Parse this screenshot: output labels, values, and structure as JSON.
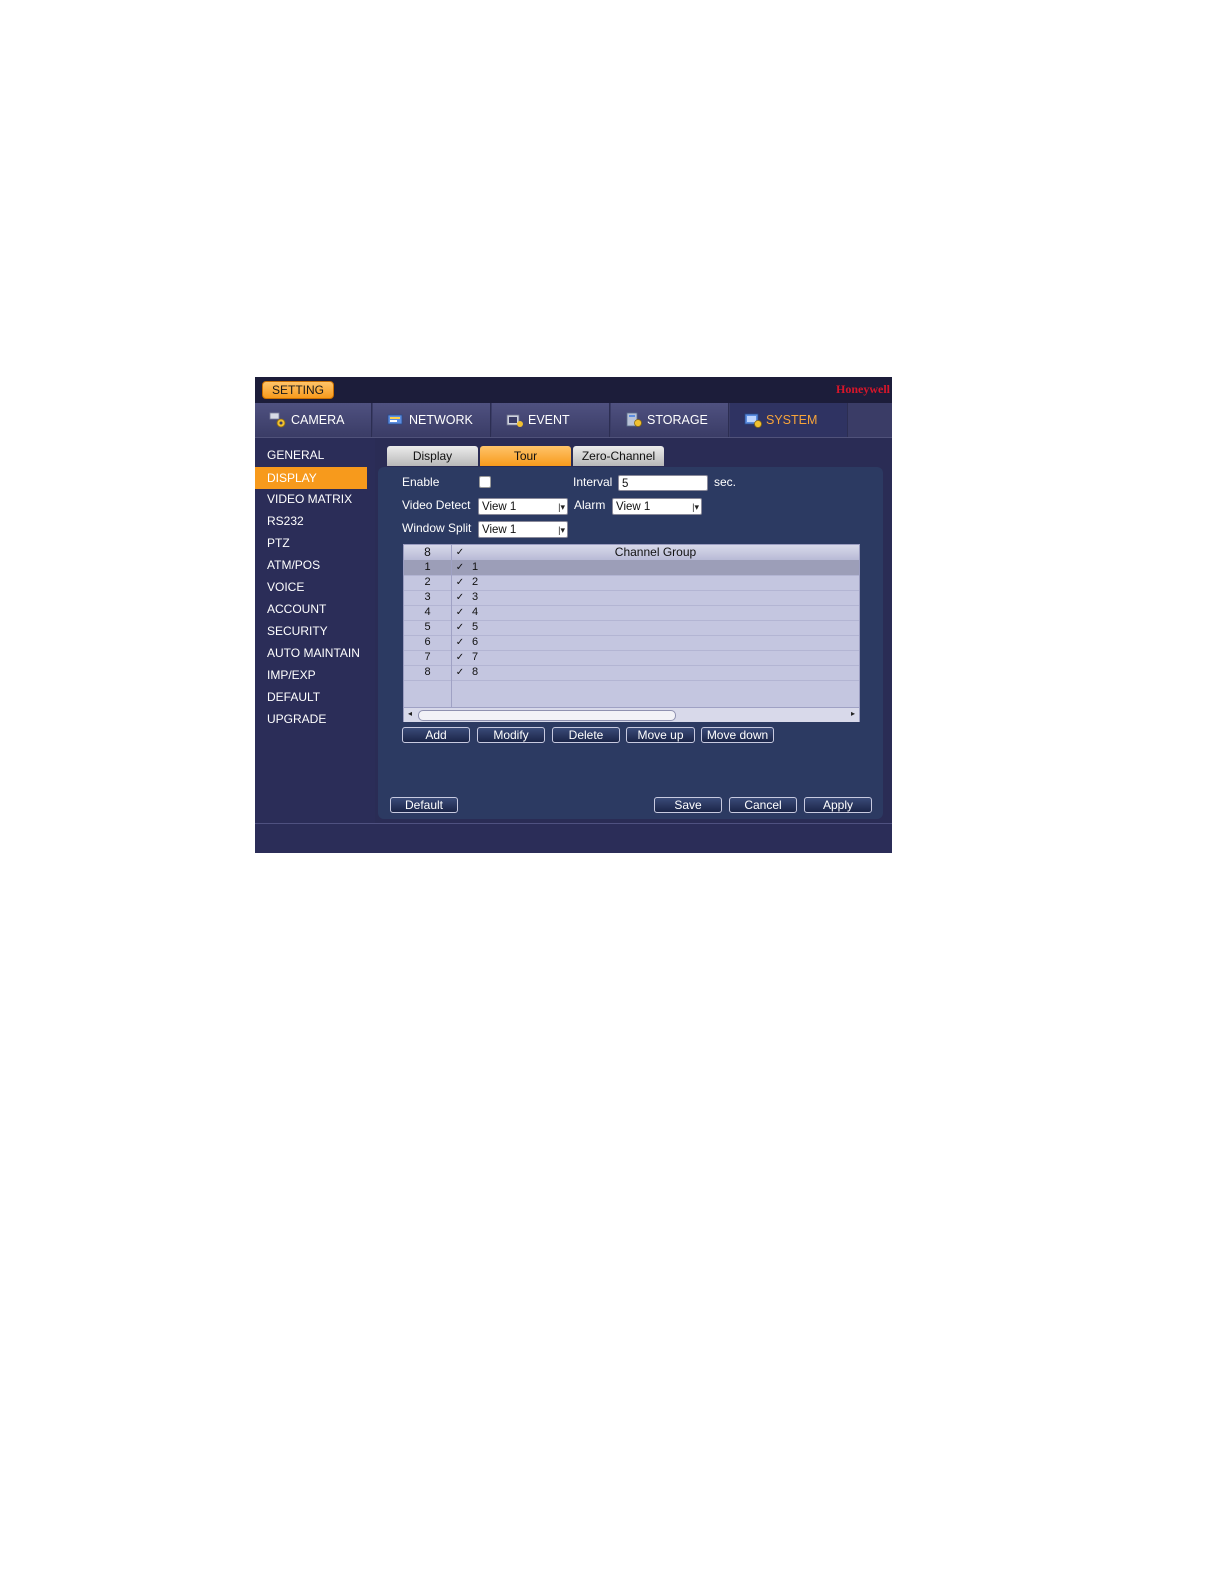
{
  "window": {
    "setting_label": "SETTING",
    "brand": "Honeywell"
  },
  "main_tabs": [
    {
      "label": "CAMERA",
      "icon": "camera-gear-icon",
      "active": false
    },
    {
      "label": "NETWORK",
      "icon": "network-icon",
      "active": false
    },
    {
      "label": "EVENT",
      "icon": "event-icon",
      "active": false
    },
    {
      "label": "STORAGE",
      "icon": "storage-icon",
      "active": false
    },
    {
      "label": "SYSTEM",
      "icon": "system-icon",
      "active": true
    }
  ],
  "sidebar": {
    "items": [
      {
        "label": "GENERAL"
      },
      {
        "label": "DISPLAY",
        "active": true
      },
      {
        "label": "VIDEO MATRIX"
      },
      {
        "label": "RS232"
      },
      {
        "label": "PTZ"
      },
      {
        "label": "ATM/POS"
      },
      {
        "label": "VOICE"
      },
      {
        "label": "ACCOUNT"
      },
      {
        "label": "SECURITY"
      },
      {
        "label": "AUTO MAINTAIN"
      },
      {
        "label": "IMP/EXP"
      },
      {
        "label": "DEFAULT"
      },
      {
        "label": "UPGRADE"
      }
    ]
  },
  "sub_tabs": [
    {
      "label": "Display",
      "active": false
    },
    {
      "label": "Tour",
      "active": true
    },
    {
      "label": "Zero-Channel",
      "active": false
    }
  ],
  "form": {
    "enable_label": "Enable",
    "enable_checked": false,
    "interval_label": "Interval",
    "interval_value": "5",
    "interval_unit": "sec.",
    "video_detect_label": "Video Detect",
    "video_detect_value": "View 1",
    "alarm_label": "Alarm",
    "alarm_value": "View 1",
    "window_split_label": "Window Split",
    "window_split_value": "View 1"
  },
  "table": {
    "header": {
      "num": "8",
      "check": "✓",
      "group": "Channel Group"
    },
    "rows": [
      {
        "num": "1",
        "check": "✓",
        "group": "1"
      },
      {
        "num": "2",
        "check": "✓",
        "group": "2"
      },
      {
        "num": "3",
        "check": "✓",
        "group": "3"
      },
      {
        "num": "4",
        "check": "✓",
        "group": "4"
      },
      {
        "num": "5",
        "check": "✓",
        "group": "5"
      },
      {
        "num": "6",
        "check": "✓",
        "group": "6"
      },
      {
        "num": "7",
        "check": "✓",
        "group": "7"
      },
      {
        "num": "8",
        "check": "✓",
        "group": "8"
      }
    ],
    "scroll_left": "◂",
    "scroll_right": "▸"
  },
  "table_buttons": {
    "add": "Add",
    "modify": "Modify",
    "delete": "Delete",
    "move_up": "Move up",
    "move_down": "Move down"
  },
  "footer_buttons": {
    "default": "Default",
    "save": "Save",
    "cancel": "Cancel",
    "apply": "Apply"
  },
  "colors": {
    "accent": "#f79a1c",
    "brand": "#d7162a",
    "background": "#2a2c55"
  }
}
